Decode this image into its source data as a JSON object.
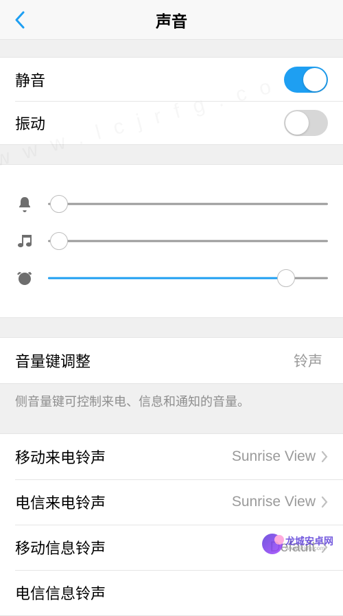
{
  "header": {
    "title": "声音"
  },
  "switches": {
    "mute": {
      "label": "静音",
      "state": "on"
    },
    "vibrate": {
      "label": "振动",
      "state": "off"
    }
  },
  "sliders": {
    "ringtone": {
      "icon": "bell-icon",
      "percent": 4
    },
    "media": {
      "icon": "music-icon",
      "percent": 4
    },
    "alarm": {
      "icon": "alarm-icon",
      "percent": 85
    }
  },
  "volume_key": {
    "label": "音量键调整",
    "value": "铃声",
    "note": "侧音量键可控制来电、信息和通知的音量。"
  },
  "ringtones": [
    {
      "label": "移动来电铃声",
      "value": "Sunrise View"
    },
    {
      "label": "电信来电铃声",
      "value": "Sunrise View"
    },
    {
      "label": "移动信息铃声",
      "value": "Default"
    },
    {
      "label": "电信信息铃声",
      "value": ""
    }
  ],
  "watermark": {
    "line1": "龙城安卓网",
    "line2": "www.lcjrfg.com"
  }
}
